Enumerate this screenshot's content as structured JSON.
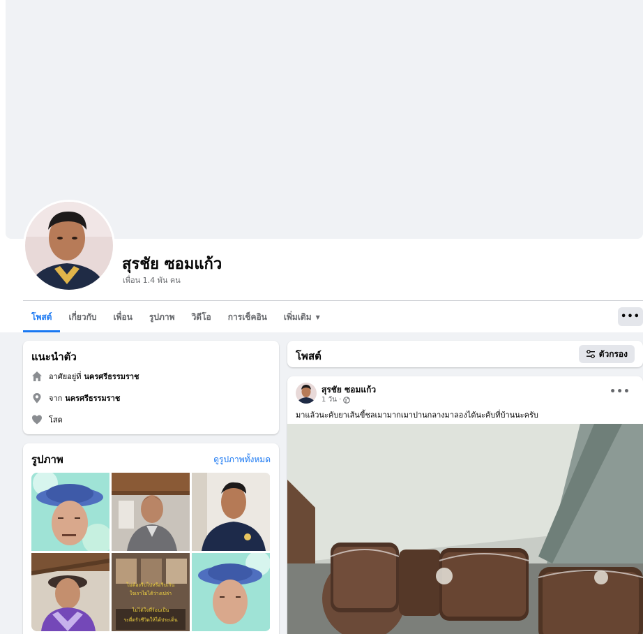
{
  "profile": {
    "name": "สุรชัย ซอมแก้ว",
    "friends": "เพื่อน 1.4 พัน คน"
  },
  "tabs": [
    {
      "label": "โพสต์",
      "active": true
    },
    {
      "label": "เกี่ยวกับ"
    },
    {
      "label": "เพื่อน"
    },
    {
      "label": "รูปภาพ"
    },
    {
      "label": "วิดีโอ"
    },
    {
      "label": "การเช็คอิน"
    },
    {
      "label": "เพิ่มเติม"
    }
  ],
  "more_button": "•••",
  "intro": {
    "title": "แนะนำตัว",
    "lives_prefix": "อาศัยอยู่ที่",
    "lives_value": "นครศรีธรรมราช",
    "from_prefix": "จาก",
    "from_value": "นครศรีธรรมราช",
    "relationship": "โสด"
  },
  "photos": {
    "title": "รูปภาพ",
    "see_all": "ดูรูปภาพทั้งหมด",
    "overlay_lines": [
      "ไม่ต้องรีบไปหรือรีบเกิน",
      "ใจเราไม่ได้ว่างเปล่า",
      "ไม่ได้ใจที่ร้อนเป็น",
      "ระดี่ตรัวชีวิตให้ได้ประเด็น"
    ]
  },
  "posts_header": {
    "title": "โพสต์",
    "filter_label": "ตัวกรอง"
  },
  "post": {
    "author": "สุรชัย ซอมแก้ว",
    "time": "1 วัน ·",
    "text": "มาแล้วนะคับยาเส้นขี้ชลเมามากเมาปานกลางมาลองได้นะคับที่บ้านนะครับ",
    "options": "•••"
  },
  "colors": {
    "accent": "#1877f2",
    "secondary_text": "#65676b",
    "background": "#f0f2f5"
  }
}
